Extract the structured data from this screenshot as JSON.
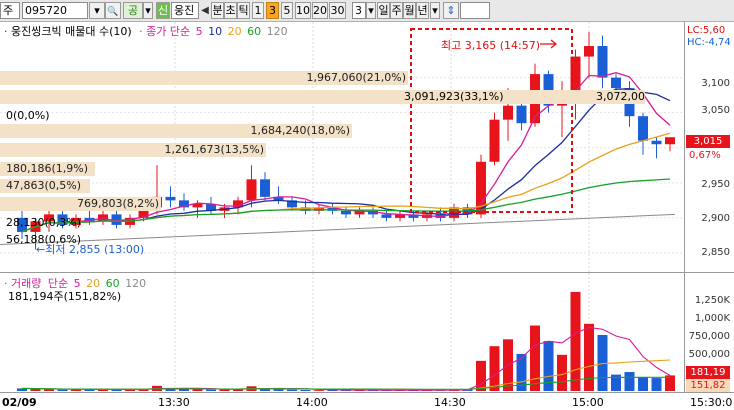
{
  "toolbar": {
    "market": "주",
    "code": "095720",
    "search_glyph": "🔍",
    "public_label": "공",
    "credit_label": "신",
    "stock_name": "웅진",
    "prev_glyph": "◀",
    "period_labels": [
      "분",
      "초",
      "틱"
    ],
    "interval_buttons": [
      "1",
      "3",
      "5",
      "10",
      "20",
      "30"
    ],
    "selected_interval": "3",
    "count_value": "3",
    "daily_labels": [
      "일",
      "주",
      "월",
      "년"
    ],
    "updown_glyph": "⇕"
  },
  "price_pane": {
    "legend_name": "웅진씽크빅 매물대 수(10)",
    "ma_legend": {
      "title": "종가 단순",
      "periods": [
        "5",
        "10",
        "20",
        "60",
        "120"
      ],
      "colors": [
        "#d81b9b",
        "#1a2ea0",
        "#e8a11a",
        "#17a02a",
        "#8a8a8a"
      ]
    },
    "lc_label": "LC:5,60",
    "hc_label": "HC:-4,74",
    "current_price": "3,015",
    "current_change": "0,67%",
    "high_annotation": "최고 3,165 (14:57)",
    "low_annotation": "←최저 2,855 (13:00)",
    "volume_profile": [
      {
        "label": "1,967,060(21,0%)"
      },
      {
        "label": "3,091,923(33,1%)"
      },
      {
        "label": "3,072,00"
      },
      {
        "label": "0(0,0%)"
      },
      {
        "label": "1,684,240(18,0%)"
      },
      {
        "label": "1,261,673(13,5%)"
      },
      {
        "label": "180,186(1,9%)"
      },
      {
        "label": "47,863(0,5%)"
      },
      {
        "label": "769,803(8,2%)"
      },
      {
        "label": "28,130(0,3%)"
      },
      {
        "label": "56,188(0,6%)"
      }
    ],
    "y_ticks": [
      "3,100",
      "3,050",
      "3,000",
      "2,950",
      "2,900",
      "2,850"
    ]
  },
  "volume_pane": {
    "legend_name": "거래량",
    "ma_legend": {
      "title": "단순",
      "periods": [
        "5",
        "20",
        "60",
        "120"
      ],
      "colors": [
        "#d81b9b",
        "#e8a11a",
        "#17a02a",
        "#8a8a8a"
      ]
    },
    "current_volume": "181,194주(151,82%)",
    "y_ticks": [
      "1,250K",
      "1,000K",
      "750,000",
      "500,000"
    ],
    "current_tag": "181,19",
    "current_tag2": "151,82"
  },
  "time_axis": {
    "date": "02/09",
    "labels": [
      "13:30",
      "14:00",
      "14:30",
      "15:00",
      "15:30:0"
    ]
  },
  "colors": {
    "up": "#e8141b",
    "down": "#1b5fd6",
    "profile_bar": "#f3e1c8",
    "highlight_box": "#e01010"
  },
  "chart_data": {
    "type": "candlestick",
    "interval": "3분",
    "ylim": [
      2830,
      3165
    ],
    "candles": [
      {
        "o": 2900,
        "h": 2910,
        "l": 2870,
        "c": 2880
      },
      {
        "o": 2880,
        "h": 2900,
        "l": 2855,
        "c": 2895
      },
      {
        "o": 2895,
        "h": 2920,
        "l": 2880,
        "c": 2905
      },
      {
        "o": 2905,
        "h": 2915,
        "l": 2885,
        "c": 2890
      },
      {
        "o": 2890,
        "h": 2905,
        "l": 2885,
        "c": 2900
      },
      {
        "o": 2900,
        "h": 2915,
        "l": 2890,
        "c": 2895
      },
      {
        "o": 2895,
        "h": 2910,
        "l": 2890,
        "c": 2905
      },
      {
        "o": 2905,
        "h": 2910,
        "l": 2885,
        "c": 2890
      },
      {
        "o": 2890,
        "h": 2905,
        "l": 2885,
        "c": 2900
      },
      {
        "o": 2900,
        "h": 2920,
        "l": 2895,
        "c": 2915
      },
      {
        "o": 2915,
        "h": 2975,
        "l": 2905,
        "c": 2930
      },
      {
        "o": 2930,
        "h": 2945,
        "l": 2915,
        "c": 2925
      },
      {
        "o": 2925,
        "h": 2935,
        "l": 2910,
        "c": 2915
      },
      {
        "o": 2915,
        "h": 2925,
        "l": 2900,
        "c": 2920
      },
      {
        "o": 2920,
        "h": 2930,
        "l": 2905,
        "c": 2910
      },
      {
        "o": 2910,
        "h": 2920,
        "l": 2900,
        "c": 2915
      },
      {
        "o": 2915,
        "h": 2930,
        "l": 2905,
        "c": 2925
      },
      {
        "o": 2925,
        "h": 2975,
        "l": 2915,
        "c": 2955
      },
      {
        "o": 2955,
        "h": 2965,
        "l": 2925,
        "c": 2930
      },
      {
        "o": 2930,
        "h": 2945,
        "l": 2920,
        "c": 2925
      },
      {
        "o": 2925,
        "h": 2930,
        "l": 2910,
        "c": 2915
      },
      {
        "o": 2915,
        "h": 2925,
        "l": 2905,
        "c": 2910
      },
      {
        "o": 2910,
        "h": 2920,
        "l": 2905,
        "c": 2915
      },
      {
        "o": 2915,
        "h": 2920,
        "l": 2905,
        "c": 2910
      },
      {
        "o": 2910,
        "h": 2915,
        "l": 2900,
        "c": 2905
      },
      {
        "o": 2905,
        "h": 2915,
        "l": 2900,
        "c": 2910
      },
      {
        "o": 2910,
        "h": 2915,
        "l": 2900,
        "c": 2905
      },
      {
        "o": 2905,
        "h": 2910,
        "l": 2895,
        "c": 2900
      },
      {
        "o": 2900,
        "h": 2910,
        "l": 2895,
        "c": 2905
      },
      {
        "o": 2905,
        "h": 2910,
        "l": 2895,
        "c": 2900
      },
      {
        "o": 2900,
        "h": 2910,
        "l": 2895,
        "c": 2905
      },
      {
        "o": 2905,
        "h": 2915,
        "l": 2895,
        "c": 2900
      },
      {
        "o": 2900,
        "h": 2920,
        "l": 2895,
        "c": 2915
      },
      {
        "o": 2915,
        "h": 2920,
        "l": 2900,
        "c": 2905
      },
      {
        "o": 2905,
        "h": 2990,
        "l": 2900,
        "c": 2980
      },
      {
        "o": 2980,
        "h": 3050,
        "l": 2975,
        "c": 3040
      },
      {
        "o": 3040,
        "h": 3085,
        "l": 3010,
        "c": 3060
      },
      {
        "o": 3060,
        "h": 3065,
        "l": 3025,
        "c": 3035
      },
      {
        "o": 3035,
        "h": 3120,
        "l": 3030,
        "c": 3105
      },
      {
        "o": 3105,
        "h": 3110,
        "l": 3050,
        "c": 3060
      },
      {
        "o": 3060,
        "h": 3095,
        "l": 3015,
        "c": 3075
      },
      {
        "o": 3075,
        "h": 3140,
        "l": 3040,
        "c": 3130
      },
      {
        "o": 3130,
        "h": 3165,
        "l": 3100,
        "c": 3145
      },
      {
        "o": 3145,
        "h": 3160,
        "l": 3085,
        "c": 3100
      },
      {
        "o": 3100,
        "h": 3105,
        "l": 3075,
        "c": 3085
      },
      {
        "o": 3085,
        "h": 3095,
        "l": 3030,
        "c": 3045
      },
      {
        "o": 3045,
        "h": 3050,
        "l": 2990,
        "c": 3010
      },
      {
        "o": 3010,
        "h": 3015,
        "l": 2985,
        "c": 3005
      },
      {
        "o": 3005,
        "h": 3015,
        "l": 2995,
        "c": 3015
      }
    ],
    "volumes": [
      30,
      25,
      20,
      15,
      18,
      22,
      20,
      15,
      18,
      25,
      60,
      30,
      22,
      18,
      15,
      20,
      25,
      55,
      30,
      22,
      15,
      12,
      10,
      12,
      10,
      8,
      10,
      8,
      10,
      8,
      10,
      12,
      15,
      20,
      350,
      520,
      600,
      430,
      760,
      580,
      420,
      1150,
      780,
      650,
      190,
      220,
      160,
      150,
      181
    ],
    "profile_levels": [
      {
        "price": 3112,
        "pct": 21.0
      },
      {
        "price": 3080,
        "pct": 33.1
      },
      {
        "price": 3045,
        "pct": 0.0
      },
      {
        "price": 3015,
        "pct": 18.0
      },
      {
        "price": 2985,
        "pct": 13.5
      },
      {
        "price": 2957,
        "pct": 1.9
      },
      {
        "price": 2942,
        "pct": 0.5
      },
      {
        "price": 2913,
        "pct": 8.2
      },
      {
        "price": 2888,
        "pct": 0.3
      },
      {
        "price": 2862,
        "pct": 0.6
      }
    ]
  }
}
